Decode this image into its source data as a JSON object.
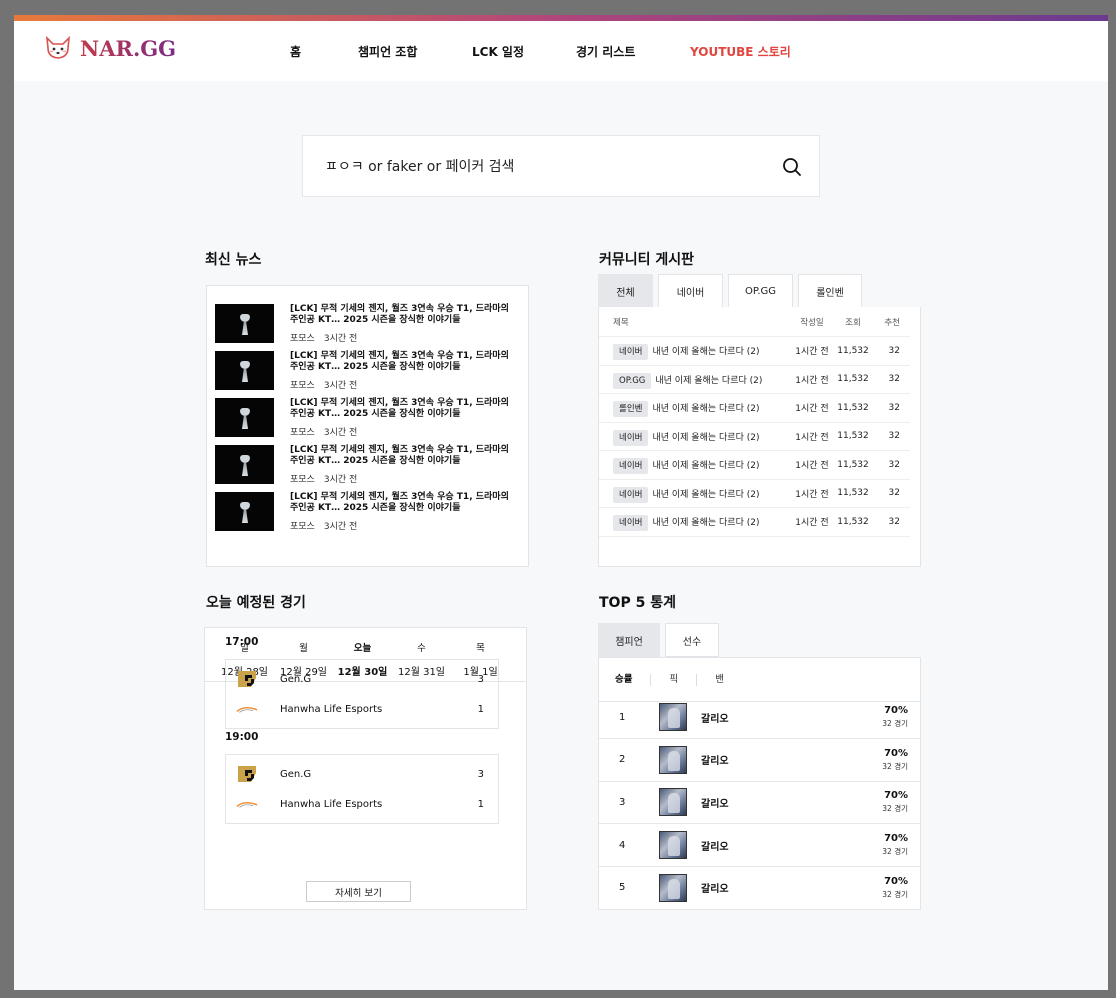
{
  "brand": {
    "name": "NAR.GG"
  },
  "nav": {
    "items": [
      {
        "label": "홈"
      },
      {
        "label": "챔피언 조합"
      },
      {
        "label": "LCK 일정"
      },
      {
        "label": "경기 리스트"
      },
      {
        "label": "YOUTUBE 스토리"
      }
    ]
  },
  "search": {
    "placeholder": "ㅍㅇㅋ or faker or 페이커 검색"
  },
  "news": {
    "title": "최신 뉴스",
    "items": [
      {
        "title": "[LCK] 무적 기세의 젠지, 월즈 3연속 우승 T1, 드라마의 주인공 KT… 2025 시즌을 장식한 이야기들",
        "source": "포모스",
        "time": "3시간 전"
      },
      {
        "title": "[LCK] 무적 기세의 젠지, 월즈 3연속 우승 T1, 드라마의 주인공 KT… 2025 시즌을 장식한 이야기들",
        "source": "포모스",
        "time": "3시간 전"
      },
      {
        "title": "[LCK] 무적 기세의 젠지, 월즈 3연속 우승 T1, 드라마의 주인공 KT… 2025 시즌을 장식한 이야기들",
        "source": "포모스",
        "time": "3시간 전"
      },
      {
        "title": "[LCK] 무적 기세의 젠지, 월즈 3연속 우승 T1, 드라마의 주인공 KT… 2025 시즌을 장식한 이야기들",
        "source": "포모스",
        "time": "3시간 전"
      },
      {
        "title": "[LCK] 무적 기세의 젠지, 월즈 3연속 우승 T1, 드라마의 주인공 KT… 2025 시즌을 장식한 이야기들",
        "source": "포모스",
        "time": "3시간 전"
      }
    ]
  },
  "community": {
    "title": "커뮤니티 게시판",
    "tabs": [
      "전체",
      "네이버",
      "OP.GG",
      "롤인벤"
    ],
    "columns": {
      "title": "제목",
      "date": "작성일",
      "views": "조회",
      "likes": "추천"
    },
    "rows": [
      {
        "source": "네이버",
        "title": "내년 이제 올해는 다르다 (2)",
        "date": "1시간 전",
        "views": "11,532",
        "likes": "32"
      },
      {
        "source": "OP.GG",
        "title": "내년 이제 올해는 다르다 (2)",
        "date": "1시간 전",
        "views": "11,532",
        "likes": "32"
      },
      {
        "source": "롤인벤",
        "title": "내년 이제 올해는 다르다 (2)",
        "date": "1시간 전",
        "views": "11,532",
        "likes": "32"
      },
      {
        "source": "네이버",
        "title": "내년 이제 올해는 다르다 (2)",
        "date": "1시간 전",
        "views": "11,532",
        "likes": "32"
      },
      {
        "source": "네이버",
        "title": "내년 이제 올해는 다르다 (2)",
        "date": "1시간 전",
        "views": "11,532",
        "likes": "32"
      },
      {
        "source": "네이버",
        "title": "내년 이제 올해는 다르다 (2)",
        "date": "1시간 전",
        "views": "11,532",
        "likes": "32"
      },
      {
        "source": "네이버",
        "title": "내년 이제 올해는 다르다 (2)",
        "date": "1시간 전",
        "views": "11,532",
        "likes": "32"
      }
    ]
  },
  "schedule": {
    "title": "오늘 예정된 경기",
    "days": [
      {
        "name": "일",
        "date": "12월 28일"
      },
      {
        "name": "월",
        "date": "12월 29일"
      },
      {
        "name": "오늘",
        "date": "12월 30일"
      },
      {
        "name": "수",
        "date": "12월 31일"
      },
      {
        "name": "목",
        "date": "1월 1일"
      }
    ],
    "matches": [
      {
        "time": "17:00",
        "team1": "Gen.G",
        "score1": "3",
        "team2": "Hanwha Life Esports",
        "score2": "1"
      },
      {
        "time": "19:00",
        "team1": "Gen.G",
        "score1": "3",
        "team2": "Hanwha Life Esports",
        "score2": "1"
      }
    ],
    "more_label": "자세히 보기"
  },
  "top5": {
    "title": "TOP 5 통계",
    "tabs": [
      "챔피언",
      "선수"
    ],
    "stat_tabs": [
      "승률",
      "픽",
      "밴"
    ],
    "rows": [
      {
        "rank": "1",
        "name": "갈리오",
        "rate": "70%",
        "games": "32 경기"
      },
      {
        "rank": "2",
        "name": "갈리오",
        "rate": "70%",
        "games": "32 경기"
      },
      {
        "rank": "3",
        "name": "갈리오",
        "rate": "70%",
        "games": "32 경기"
      },
      {
        "rank": "4",
        "name": "갈리오",
        "rate": "70%",
        "games": "32 경기"
      },
      {
        "rank": "5",
        "name": "갈리오",
        "rate": "70%",
        "games": "32 경기"
      }
    ]
  },
  "colors": {
    "accent_red": "#e0453f",
    "gradient_start": "#e8793a",
    "gradient_end": "#6b3a8f"
  }
}
